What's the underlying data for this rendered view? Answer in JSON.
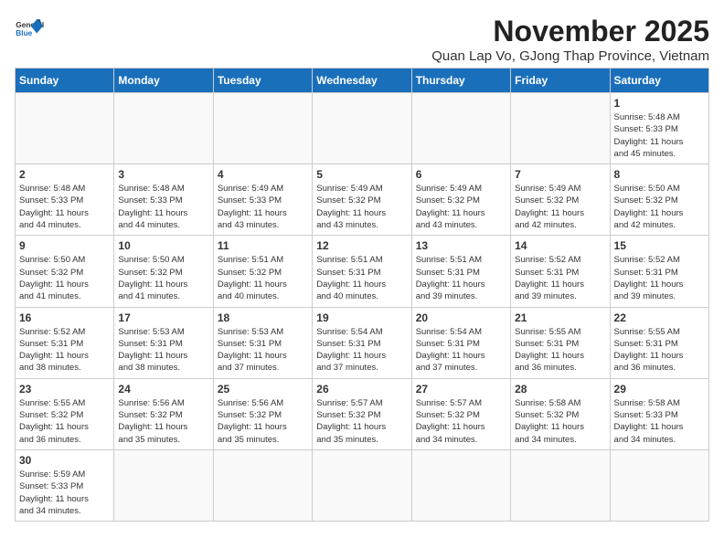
{
  "header": {
    "logo_general": "General",
    "logo_blue": "Blue",
    "month_title": "November 2025",
    "subtitle": "Quan Lap Vo, GJong Thap Province, Vietnam"
  },
  "days_of_week": [
    "Sunday",
    "Monday",
    "Tuesday",
    "Wednesday",
    "Thursday",
    "Friday",
    "Saturday"
  ],
  "weeks": [
    [
      {
        "num": "",
        "info": ""
      },
      {
        "num": "",
        "info": ""
      },
      {
        "num": "",
        "info": ""
      },
      {
        "num": "",
        "info": ""
      },
      {
        "num": "",
        "info": ""
      },
      {
        "num": "",
        "info": ""
      },
      {
        "num": "1",
        "info": "Sunrise: 5:48 AM\nSunset: 5:33 PM\nDaylight: 11 hours\nand 45 minutes."
      }
    ],
    [
      {
        "num": "2",
        "info": "Sunrise: 5:48 AM\nSunset: 5:33 PM\nDaylight: 11 hours\nand 44 minutes."
      },
      {
        "num": "3",
        "info": "Sunrise: 5:48 AM\nSunset: 5:33 PM\nDaylight: 11 hours\nand 44 minutes."
      },
      {
        "num": "4",
        "info": "Sunrise: 5:49 AM\nSunset: 5:33 PM\nDaylight: 11 hours\nand 43 minutes."
      },
      {
        "num": "5",
        "info": "Sunrise: 5:49 AM\nSunset: 5:32 PM\nDaylight: 11 hours\nand 43 minutes."
      },
      {
        "num": "6",
        "info": "Sunrise: 5:49 AM\nSunset: 5:32 PM\nDaylight: 11 hours\nand 43 minutes."
      },
      {
        "num": "7",
        "info": "Sunrise: 5:49 AM\nSunset: 5:32 PM\nDaylight: 11 hours\nand 42 minutes."
      },
      {
        "num": "8",
        "info": "Sunrise: 5:50 AM\nSunset: 5:32 PM\nDaylight: 11 hours\nand 42 minutes."
      }
    ],
    [
      {
        "num": "9",
        "info": "Sunrise: 5:50 AM\nSunset: 5:32 PM\nDaylight: 11 hours\nand 41 minutes."
      },
      {
        "num": "10",
        "info": "Sunrise: 5:50 AM\nSunset: 5:32 PM\nDaylight: 11 hours\nand 41 minutes."
      },
      {
        "num": "11",
        "info": "Sunrise: 5:51 AM\nSunset: 5:32 PM\nDaylight: 11 hours\nand 40 minutes."
      },
      {
        "num": "12",
        "info": "Sunrise: 5:51 AM\nSunset: 5:31 PM\nDaylight: 11 hours\nand 40 minutes."
      },
      {
        "num": "13",
        "info": "Sunrise: 5:51 AM\nSunset: 5:31 PM\nDaylight: 11 hours\nand 39 minutes."
      },
      {
        "num": "14",
        "info": "Sunrise: 5:52 AM\nSunset: 5:31 PM\nDaylight: 11 hours\nand 39 minutes."
      },
      {
        "num": "15",
        "info": "Sunrise: 5:52 AM\nSunset: 5:31 PM\nDaylight: 11 hours\nand 39 minutes."
      }
    ],
    [
      {
        "num": "16",
        "info": "Sunrise: 5:52 AM\nSunset: 5:31 PM\nDaylight: 11 hours\nand 38 minutes."
      },
      {
        "num": "17",
        "info": "Sunrise: 5:53 AM\nSunset: 5:31 PM\nDaylight: 11 hours\nand 38 minutes."
      },
      {
        "num": "18",
        "info": "Sunrise: 5:53 AM\nSunset: 5:31 PM\nDaylight: 11 hours\nand 37 minutes."
      },
      {
        "num": "19",
        "info": "Sunrise: 5:54 AM\nSunset: 5:31 PM\nDaylight: 11 hours\nand 37 minutes."
      },
      {
        "num": "20",
        "info": "Sunrise: 5:54 AM\nSunset: 5:31 PM\nDaylight: 11 hours\nand 37 minutes."
      },
      {
        "num": "21",
        "info": "Sunrise: 5:55 AM\nSunset: 5:31 PM\nDaylight: 11 hours\nand 36 minutes."
      },
      {
        "num": "22",
        "info": "Sunrise: 5:55 AM\nSunset: 5:31 PM\nDaylight: 11 hours\nand 36 minutes."
      }
    ],
    [
      {
        "num": "23",
        "info": "Sunrise: 5:55 AM\nSunset: 5:32 PM\nDaylight: 11 hours\nand 36 minutes."
      },
      {
        "num": "24",
        "info": "Sunrise: 5:56 AM\nSunset: 5:32 PM\nDaylight: 11 hours\nand 35 minutes."
      },
      {
        "num": "25",
        "info": "Sunrise: 5:56 AM\nSunset: 5:32 PM\nDaylight: 11 hours\nand 35 minutes."
      },
      {
        "num": "26",
        "info": "Sunrise: 5:57 AM\nSunset: 5:32 PM\nDaylight: 11 hours\nand 35 minutes."
      },
      {
        "num": "27",
        "info": "Sunrise: 5:57 AM\nSunset: 5:32 PM\nDaylight: 11 hours\nand 34 minutes."
      },
      {
        "num": "28",
        "info": "Sunrise: 5:58 AM\nSunset: 5:32 PM\nDaylight: 11 hours\nand 34 minutes."
      },
      {
        "num": "29",
        "info": "Sunrise: 5:58 AM\nSunset: 5:33 PM\nDaylight: 11 hours\nand 34 minutes."
      }
    ],
    [
      {
        "num": "30",
        "info": "Sunrise: 5:59 AM\nSunset: 5:33 PM\nDaylight: 11 hours\nand 34 minutes."
      },
      {
        "num": "",
        "info": ""
      },
      {
        "num": "",
        "info": ""
      },
      {
        "num": "",
        "info": ""
      },
      {
        "num": "",
        "info": ""
      },
      {
        "num": "",
        "info": ""
      },
      {
        "num": "",
        "info": ""
      }
    ]
  ]
}
